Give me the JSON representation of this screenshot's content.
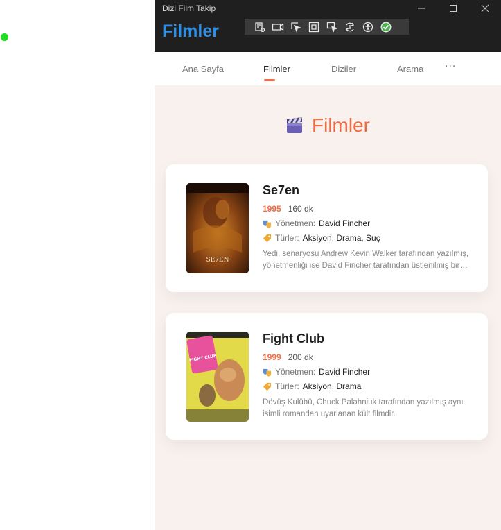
{
  "window": {
    "title": "Dizi Film Takip"
  },
  "app": {
    "title": "Filmler"
  },
  "debug_toolbar": {
    "icons": [
      "live-visual-tree-icon",
      "record-icon",
      "select-element-icon",
      "display-layout-adorners-icon",
      "track-focused-element-icon",
      "hot-reload-icon",
      "accessibility-checker-icon",
      "status-ok-icon"
    ]
  },
  "nav": {
    "tabs": [
      {
        "label": "Ana Sayfa",
        "active": false
      },
      {
        "label": "Filmler",
        "active": true
      },
      {
        "label": "Diziler",
        "active": false
      },
      {
        "label": "Arama",
        "active": false
      }
    ],
    "more": "···"
  },
  "page": {
    "heading": "Filmler",
    "heading_icon": "clapperboard-icon"
  },
  "movies": [
    {
      "title": "Se7en",
      "year": "1995",
      "duration": "160 dk",
      "director_label": "Yönetmen:",
      "director": "David Fincher",
      "genres_label": "Türler:",
      "genres": "Aksiyon, Drama, Suç",
      "description": "Yedi, senaryosu Andrew Kevin Walker tarafından yazılmış, yönetmenliği ise David Fincher tarafından üstlenilmiş bir gerilim filmidir.",
      "poster_text": "SE7EN"
    },
    {
      "title": "Fight Club",
      "year": "1999",
      "duration": "200 dk",
      "director_label": "Yönetmen:",
      "director": "David Fincher",
      "genres_label": "Türler:",
      "genres": "Aksiyon, Drama",
      "description": "Dövüş Kulübü, Chuck Palahniuk tarafından yazılmış aynı isimli romandan uyarlanan kült filmdir.",
      "poster_text": "FIGHT CLUB"
    }
  ],
  "colors": {
    "accent": "#f26a40",
    "brand": "#2d8fe6",
    "titlebar": "#1f1f1f",
    "page_bg": "#f8f1ed"
  }
}
